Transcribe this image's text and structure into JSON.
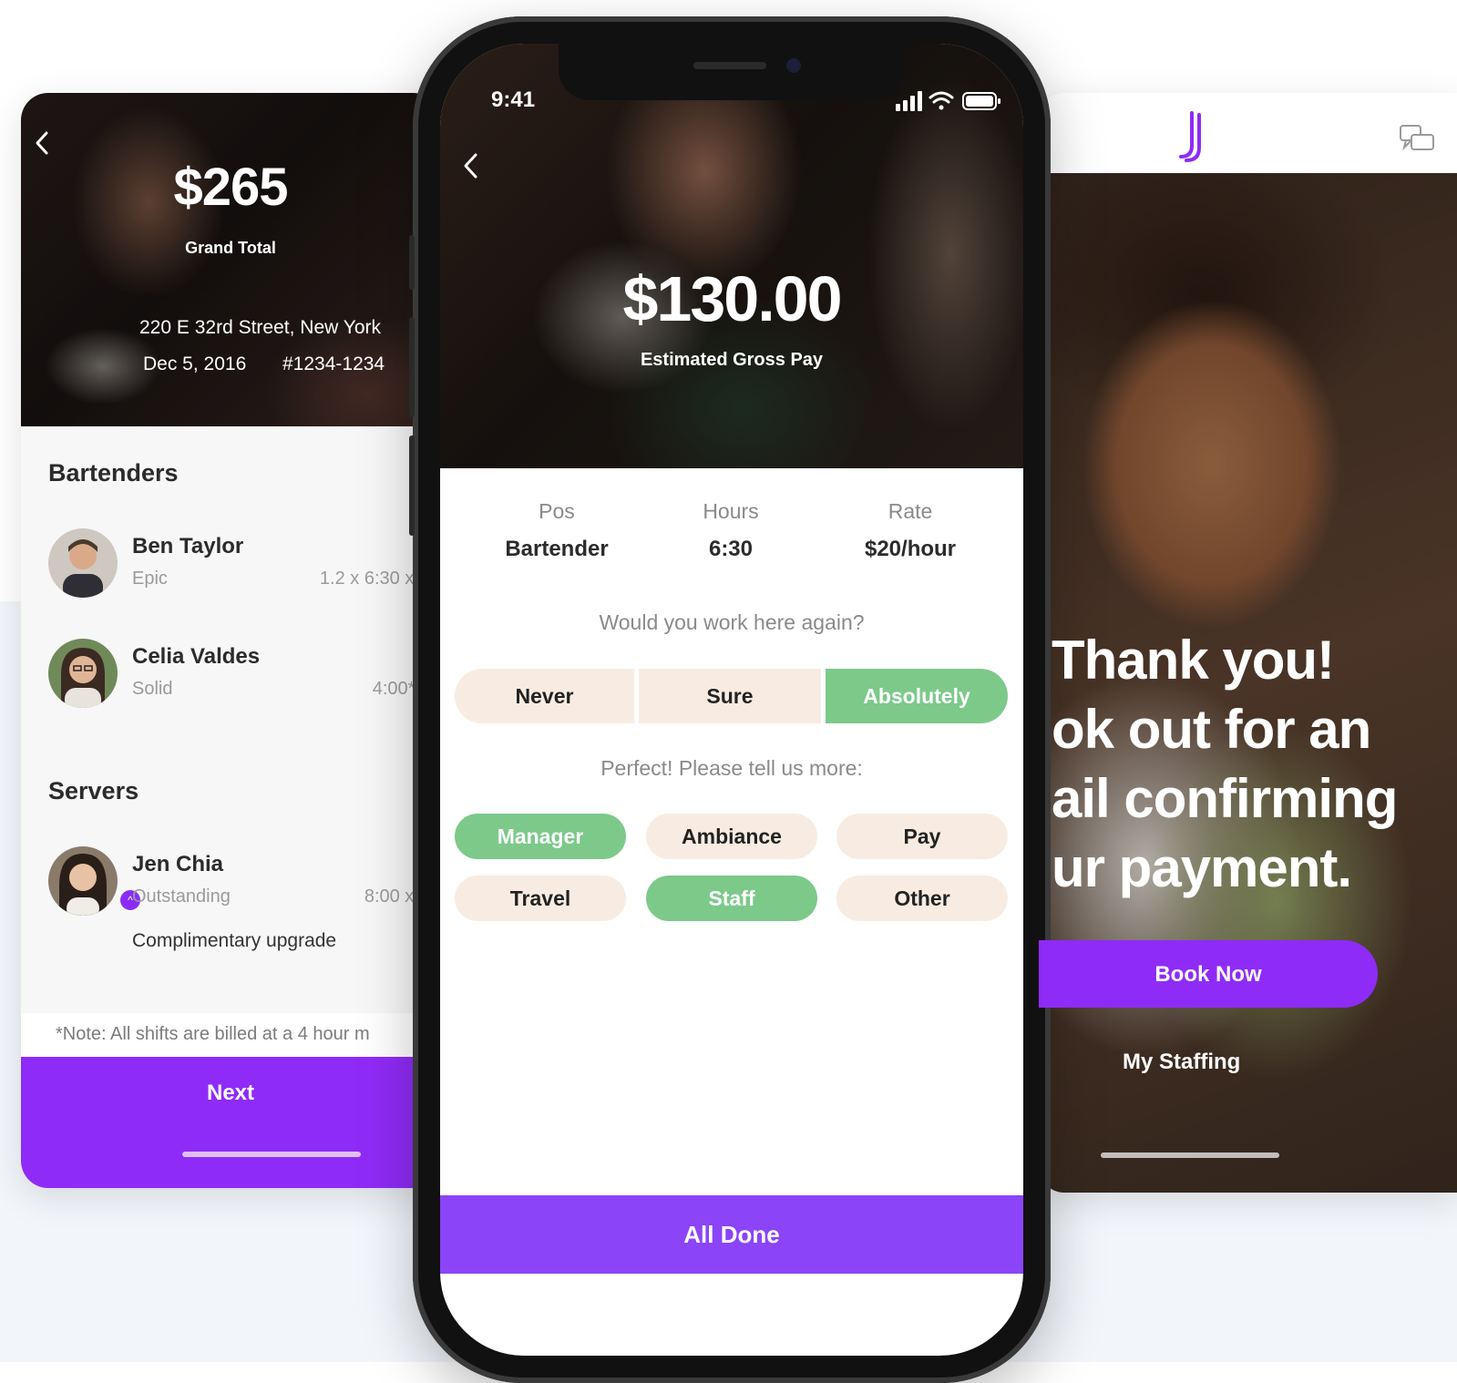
{
  "left_screen": {
    "amount": "$265",
    "amount_label": "Grand Total",
    "address": "220 E 32rd Street, New York",
    "date": "Dec 5, 2016",
    "order_number": "#1234-1234",
    "sections": [
      {
        "title": "Bartenders",
        "people": [
          {
            "name": "Ben Taylor",
            "tier": "Epic",
            "calc": "1.2 x 6:30 x $"
          },
          {
            "name": "Celia Valdes",
            "tier": "Solid",
            "calc": "4:00* x"
          }
        ]
      },
      {
        "title": "Servers",
        "people": [
          {
            "name": "Jen Chia",
            "tier": "Outstanding",
            "calc": "8:00 x $",
            "extra": "Complimentary upgrade"
          }
        ]
      }
    ],
    "note": "*Note: All shifts are billed at a 4 hour m",
    "next_label": "Next"
  },
  "center_screen": {
    "status_time": "9:41",
    "amount": "$130.00",
    "amount_label": "Estimated Gross Pay",
    "stats": [
      {
        "label": "Pos",
        "value": "Bartender"
      },
      {
        "label": "Hours",
        "value": "6:30"
      },
      {
        "label": "Rate",
        "value": "$20/hour"
      }
    ],
    "question": "Would you work here again?",
    "answers": [
      "Never",
      "Sure",
      "Absolutely"
    ],
    "selected_answer": "Absolutely",
    "followup": "Perfect! Please tell us more:",
    "tags": [
      "Manager",
      "Ambiance",
      "Pay",
      "Travel",
      "Staff",
      "Other"
    ],
    "selected_tags": [
      "Manager",
      "Staff"
    ],
    "done_label": "All Done"
  },
  "right_screen": {
    "lines": [
      "Thank you!",
      "ok out for an",
      "ail confirming",
      "ur payment."
    ],
    "book_label": "Book Now",
    "staffing_label": "My Staffing"
  },
  "colors": {
    "purple": "#8f2bf6",
    "green": "#7cc98a",
    "pill_bg": "#f8ece2"
  }
}
